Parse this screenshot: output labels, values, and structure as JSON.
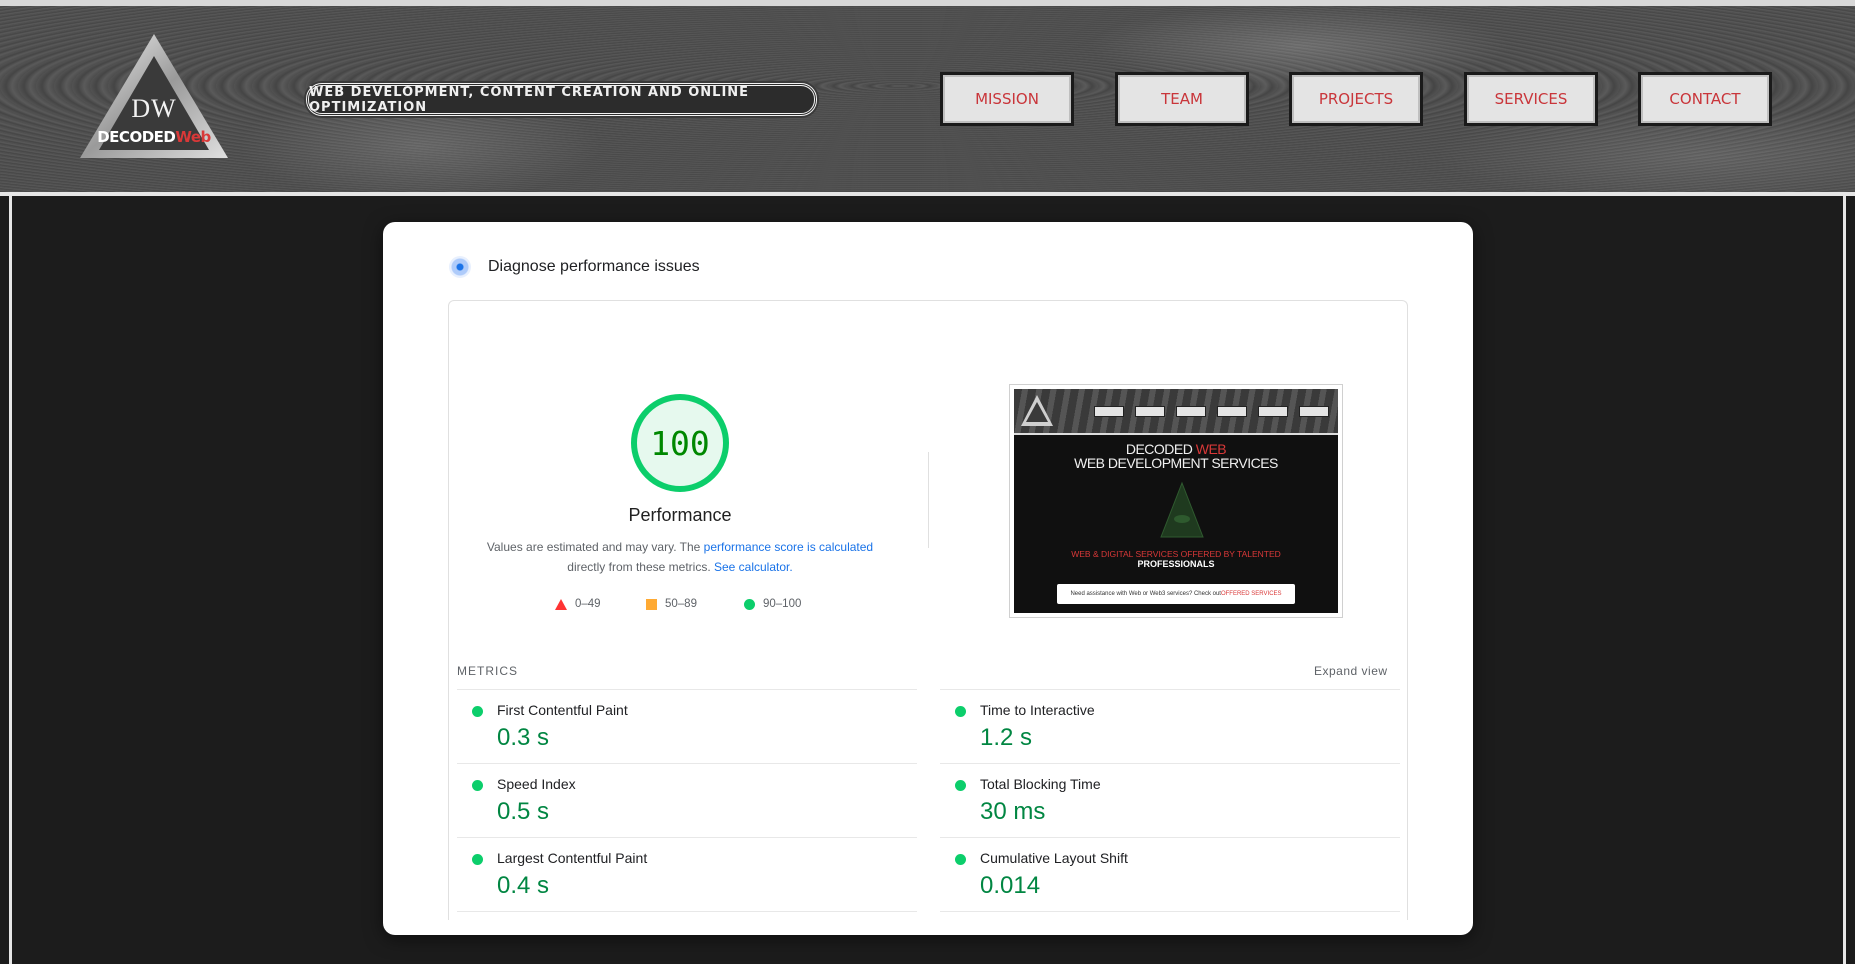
{
  "site": {
    "logo_initials": "DW",
    "logo_name_a": "DECODED",
    "logo_name_b": "Web",
    "tagline": "WEB DEVELOPMENT, CONTENT CREATION AND ONLINE OPTIMIZATION",
    "nav": [
      "MISSION",
      "TEAM",
      "PROJECTS",
      "SERVICES",
      "CONTACT"
    ]
  },
  "report": {
    "section_title": "Diagnose performance issues",
    "score": "100",
    "score_label": "Performance",
    "note_prefix": "Values are estimated and may vary. The ",
    "note_link1": "performance score is calculated",
    "note_mid": " directly from these metrics. ",
    "note_link2": "See calculator.",
    "legend": {
      "fail": "0–49",
      "average": "50–89",
      "pass": "90–100"
    },
    "metrics_label": "METRICS",
    "expand_label": "Expand view",
    "metrics": [
      {
        "name": "First Contentful Paint",
        "value": "0.3 s"
      },
      {
        "name": "Time to Interactive",
        "value": "1.2 s"
      },
      {
        "name": "Speed Index",
        "value": "0.5 s"
      },
      {
        "name": "Total Blocking Time",
        "value": "30 ms"
      },
      {
        "name": "Largest Contentful Paint",
        "value": "0.4 s"
      },
      {
        "name": "Cumulative Layout Shift",
        "value": "0.014"
      }
    ]
  },
  "thumbnail": {
    "line1_a": "DECODED ",
    "line1_b": "WEB",
    "line2": "WEB DEVELOPMENT SERVICES",
    "line3": "WEB & DIGITAL SERVICES OFFERED BY TALENTED",
    "line4": "PROFESSIONALS",
    "box_text_a": "Need assistance with Web or Web3 services? Check out ",
    "box_text_b": "OFFERED SERVICES"
  },
  "colors": {
    "brand_red": "#d93838",
    "pass_green": "#0cce6b",
    "score_text": "#008800",
    "link_blue": "#1a73e8"
  }
}
